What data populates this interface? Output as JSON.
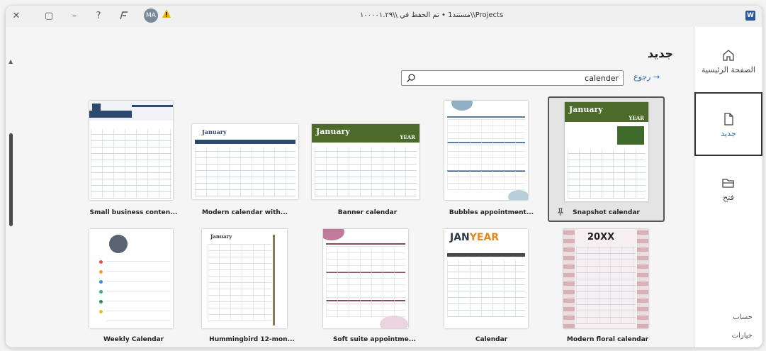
{
  "window": {
    "doc_title": "مستند1 • تم الحفظ في \\\\١٠٠٠٠١.٢٩\\\\Projects",
    "avatar_initials": "MA",
    "app_icon_letter": "W"
  },
  "rail": {
    "items": [
      {
        "label": "الصفحة الرئيسية",
        "icon": "home-icon"
      },
      {
        "label": "جديد",
        "icon": "new-document-icon"
      },
      {
        "label": "فتح",
        "icon": "folder-open-icon"
      }
    ],
    "account_label": "حساب",
    "options_label": "خيارات"
  },
  "page": {
    "heading": "جديد",
    "search_value": "calender",
    "back_label": "رجوع"
  },
  "templates": [
    {
      "title": "Small business conten...",
      "thumb_title": ""
    },
    {
      "title": "Modern calendar with...",
      "thumb_title": "January"
    },
    {
      "title": "Banner calendar",
      "thumb_title": "January",
      "thumb_sub": "YEAR"
    },
    {
      "title": "Bubbles appointment...",
      "thumb_title": ""
    },
    {
      "title": "Snapshot calendar",
      "thumb_title": "January",
      "thumb_sub": "YEAR"
    },
    {
      "title": "Weekly Calendar",
      "thumb_title": ""
    },
    {
      "title": "Hummingbird 12-mon...",
      "thumb_title": "January"
    },
    {
      "title": "Soft suite appointme...",
      "thumb_title": ""
    },
    {
      "title": "Calendar",
      "thumb_title": "JAN",
      "thumb_title_accent": "YEAR"
    },
    {
      "title": "Modern floral calendar",
      "thumb_title": "20XX"
    }
  ],
  "colors": {
    "accent_blue": "#2b6cb0",
    "banner_green": "#4c6b2a",
    "navy": "#2d4a6e",
    "mauve": "#8a4a5a"
  }
}
